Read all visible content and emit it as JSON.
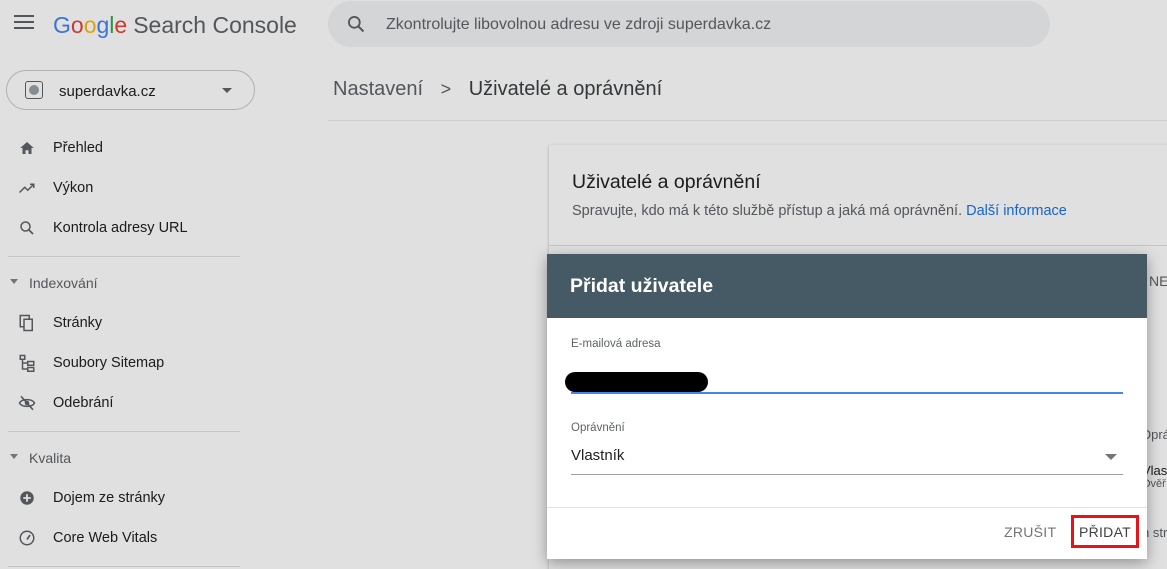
{
  "header": {
    "logo_letters": [
      "G",
      "o",
      "o",
      "g",
      "l",
      "e"
    ],
    "product": "Search Console",
    "search_placeholder": "Zkontrolujte libovolnou adresu ve zdroji superdavka.cz"
  },
  "sidebar": {
    "property": "superdavka.cz",
    "items": [
      {
        "label": "Přehled",
        "icon": "home-icon"
      },
      {
        "label": "Výkon",
        "icon": "trending-up-icon"
      },
      {
        "label": "Kontrola adresy URL",
        "icon": "search-icon"
      }
    ],
    "sections": [
      {
        "title": "Indexování",
        "items": [
          {
            "label": "Stránky",
            "icon": "pages-icon"
          },
          {
            "label": "Soubory Sitemap",
            "icon": "sitemap-icon"
          },
          {
            "label": "Odebrání",
            "icon": "eye-off-icon"
          }
        ]
      },
      {
        "title": "Kvalita",
        "items": [
          {
            "label": "Dojem ze stránky",
            "icon": "add-circle-icon"
          },
          {
            "label": "Core Web Vitals",
            "icon": "gauge-icon"
          }
        ]
      }
    ]
  },
  "breadcrumb": {
    "parent": "Nastavení",
    "separator": ">",
    "current": "Uživatelé a oprávnění"
  },
  "card": {
    "title": "Uživatelé a oprávnění",
    "description": "Spravujte, kdo má k této službě přístup a jaká má oprávnění.",
    "link": "Další informace",
    "fragments": [
      "NE",
      "Oprá",
      "Vlas",
      "Ověř",
      "n str"
    ]
  },
  "dialog": {
    "title": "Přidat uživatele",
    "email_label": "E-mailová adresa",
    "permission_label": "Oprávnění",
    "permission_value": "Vlastník",
    "cancel_label": "ZRUŠIT",
    "add_label": "PŘIDAT"
  },
  "colors": {
    "dialog_header": "#455a64",
    "link": "#1a73e8",
    "focus": "#4285f4",
    "highlight_box": "#e8121b"
  }
}
